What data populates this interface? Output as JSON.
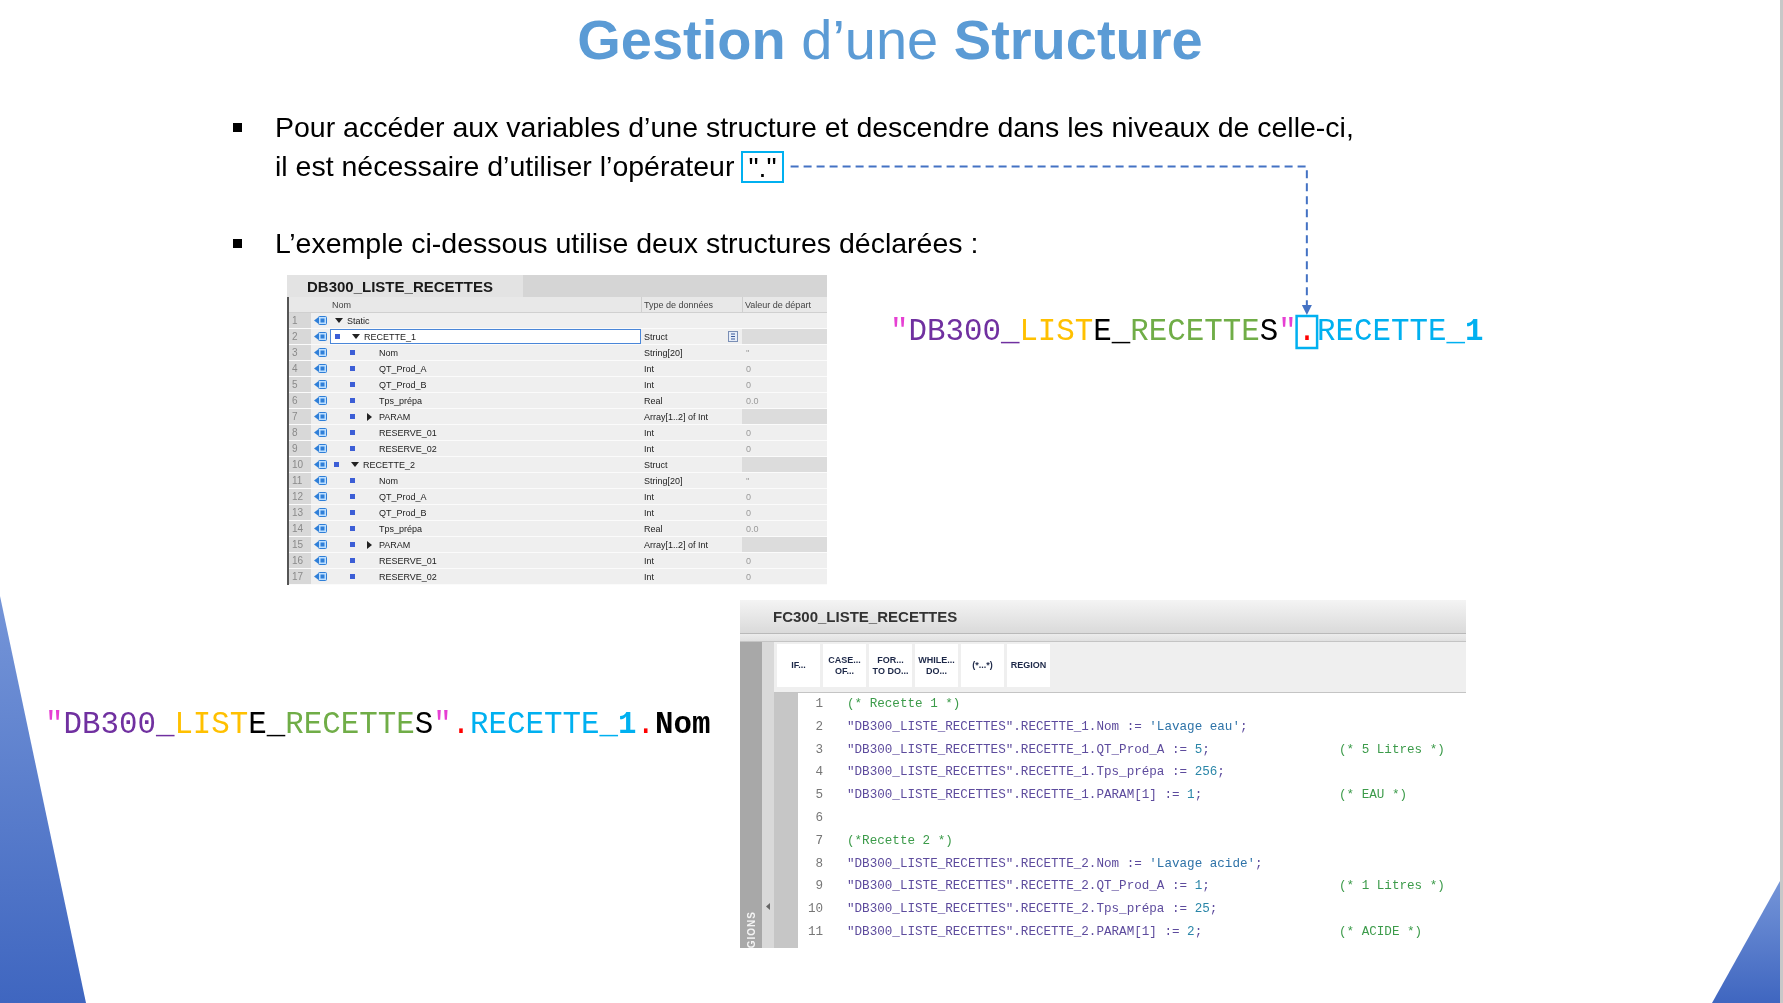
{
  "title": "**Gestion** d’une **Structure**",
  "bullets": [
    {
      "lines": [
        "Pour accéder aux variables d’une structure et descendre dans les niveaux de celle-ci,",
        "il est nécessaire d’utiliser l’opérateur"
      ],
      "operator": "\".\""
    },
    {
      "lines": [
        "L’exemple ci-dessous utilise deux structures déclarées :"
      ]
    }
  ],
  "db_table": {
    "title": "DB300_LISTE_RECETTES",
    "columns": [
      "Nom",
      "Type de données",
      "Valeur de départ"
    ],
    "rows": [
      {
        "number": "1",
        "name": "Static",
        "expanded": true,
        "selected": false,
        "children": [
          {
            "number": "2",
            "name": "RECETTE_1",
            "type": "Struct",
            "expanded": true,
            "selected": true,
            "children": [
              {
                "number": "3",
                "name": "Nom",
                "type": "String[20]",
                "value": "''",
                "selected": false
              },
              {
                "number": "4",
                "name": "QT_Prod_A",
                "type": "Int",
                "value": "0",
                "selected": false
              },
              {
                "number": "5",
                "name": "QT_Prod_B",
                "type": "Int",
                "value": "0",
                "selected": false
              },
              {
                "number": "6",
                "name": "Tps_prépa",
                "type": "Real",
                "value": "0.0",
                "selected": false
              },
              {
                "number": "7",
                "name": "PARAM",
                "type": "Array[1..2] of Int",
                "expanded": false,
                "selected": false
              },
              {
                "number": "8",
                "name": "RESERVE_01",
                "type": "Int",
                "value": "0",
                "selected": false
              },
              {
                "number": "9",
                "name": "RESERVE_02",
                "type": "Int",
                "value": "0",
                "selected": false
              }
            ]
          },
          {
            "number": "10",
            "name": "RECETTE_2",
            "type": "Struct",
            "expanded": true,
            "selected": false,
            "children": [
              {
                "number": "11",
                "name": "Nom",
                "type": "String[20]",
                "value": "''",
                "selected": false
              },
              {
                "number": "12",
                "name": "QT_Prod_A",
                "type": "Int",
                "value": "0",
                "selected": false
              },
              {
                "number": "13",
                "name": "QT_Prod_B",
                "type": "Int",
                "value": "0",
                "selected": false
              },
              {
                "number": "14",
                "name": "Tps_prépa",
                "type": "Real",
                "value": "0.0",
                "selected": false
              },
              {
                "number": "15",
                "name": "PARAM",
                "type": "Array[1..2] of Int",
                "expanded": false,
                "selected": false
              },
              {
                "number": "16",
                "name": "RESERVE_01",
                "type": "Int",
                "value": "0",
                "selected": false
              },
              {
                "number": "17",
                "name": "RESERVE_02",
                "type": "Int",
                "value": "0",
                "selected": false
              }
            ]
          }
        ]
      }
    ]
  },
  "struct_expression": {
    "segments": [
      {
        "text": "\"",
        "color": "#e63fd3",
        "boxed": false
      },
      {
        "text": "DB300_",
        "color": "#7030a0",
        "boxed": false
      },
      {
        "text": "LIST",
        "color": "#ffc000",
        "boxed": false
      },
      {
        "text": "E_",
        "color": "#000000",
        "boxed": false
      },
      {
        "text": "RECETTE",
        "color": "#70ad47",
        "boxed": false
      },
      {
        "text": "S",
        "color": "#000000",
        "boxed": false
      },
      {
        "text": "\"",
        "color": "#e63fd3",
        "boxed": false
      },
      {
        "text": ".",
        "color": "#ff0000",
        "boxed": true
      },
      {
        "text": "RECETTE_**1**",
        "color": "#00b0f0",
        "boxed": false
      }
    ]
  },
  "member_expression": {
    "segments": [
      {
        "text": "\"",
        "color": "#e63fd3",
        "boxed": false
      },
      {
        "text": "DB300_",
        "color": "#7030a0",
        "boxed": false
      },
      {
        "text": "LIST",
        "color": "#ffc000",
        "boxed": false
      },
      {
        "text": "E_",
        "color": "#000000",
        "boxed": false
      },
      {
        "text": "RECETTE",
        "color": "#70ad47",
        "boxed": false
      },
      {
        "text": "S",
        "color": "#000000",
        "boxed": false
      },
      {
        "text": "\"",
        "color": "#e63fd3",
        "boxed": false
      },
      {
        "text": ".",
        "color": "#ff0000",
        "boxed": false
      },
      {
        "text": "RECETTE_**1**",
        "color": "#00b0f0",
        "boxed": false
      },
      {
        "text": ".",
        "color": "#ff0000",
        "boxed": false
      },
      {
        "text": "**Nom**",
        "color": "#000000",
        "boxed": false
      }
    ]
  },
  "editor": {
    "title": "FC300_LISTE_RECETTES",
    "toolbar": [
      {
        "lines": [
          "IF..."
        ]
      },
      {
        "lines": [
          "CASE...",
          "OF..."
        ]
      },
      {
        "lines": [
          "FOR...",
          "TO DO..."
        ]
      },
      {
        "lines": [
          "WHILE...",
          "DO..."
        ]
      },
      {
        "lines": [
          "(*...*)"
        ]
      },
      {
        "lines": [
          "REGION"
        ]
      }
    ],
    "side_label": "GIONS",
    "lines": [
      {
        "number": "1",
        "comment": "(* Recette 1 *)"
      },
      {
        "number": "2",
        "target": "\"DB300_LISTE_RECETTES\".RECETTE_1.Nom",
        "assign": ":=",
        "value": {
          "text": "'Lavage eau'",
          "kind": "string"
        },
        "end": ";"
      },
      {
        "number": "3",
        "target": "\"DB300_LISTE_RECETTES\".RECETTE_1.QT_Prod_A",
        "assign": ":=",
        "value": {
          "text": "5",
          "kind": "number"
        },
        "end": ";",
        "comment": "(* 5 Litres *)"
      },
      {
        "number": "4",
        "target": "\"DB300_LISTE_RECETTES\".RECETTE_1.Tps_prépa",
        "assign": ":=",
        "value": {
          "text": "256",
          "kind": "number"
        },
        "end": ";"
      },
      {
        "number": "5",
        "target": "\"DB300_LISTE_RECETTES\".RECETTE_1.PARAM[1]",
        "assign": ":=",
        "value": {
          "text": "1",
          "kind": "number"
        },
        "end": ";",
        "comment": "(* EAU *)"
      },
      {
        "number": "6"
      },
      {
        "number": "7",
        "comment": "(*Recette 2 *)"
      },
      {
        "number": "8",
        "target": "\"DB300_LISTE_RECETTES\".RECETTE_2.Nom",
        "assign": ":=",
        "value": {
          "text": "'Lavage acide'",
          "kind": "string"
        },
        "end": ";"
      },
      {
        "number": "9",
        "target": "\"DB300_LISTE_RECETTES\".RECETTE_2.QT_Prod_A",
        "assign": ":=",
        "value": {
          "text": "1",
          "kind": "number"
        },
        "end": ";",
        "comment": "(* 1 Litres *)"
      },
      {
        "number": "10",
        "target": "\"DB300_LISTE_RECETTES\".RECETTE_2.Tps_prépa",
        "assign": ":=",
        "value": {
          "text": "25",
          "kind": "number"
        },
        "end": ";"
      },
      {
        "number": "11",
        "target": "\"DB300_LISTE_RECETTES\".RECETTE_2.PARAM[1]",
        "assign": ":=",
        "value": {
          "text": "2",
          "kind": "number"
        },
        "end": ";",
        "comment": "(* ACIDE *)"
      }
    ]
  }
}
